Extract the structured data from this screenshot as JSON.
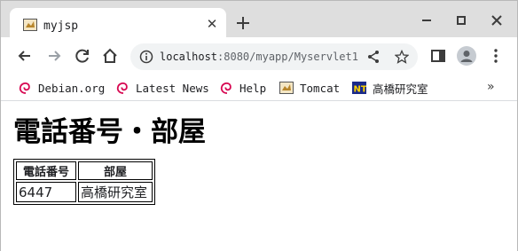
{
  "tab": {
    "title": "myjsp"
  },
  "address": {
    "host": "localhost",
    "rest": ":8080/myapp/Myservlet1"
  },
  "bookmarks": [
    {
      "label": "Debian.org",
      "icon": "debian-swirl-icon"
    },
    {
      "label": "Latest News",
      "icon": "debian-swirl-icon"
    },
    {
      "label": "Help",
      "icon": "debian-swirl-icon"
    },
    {
      "label": "Tomcat",
      "icon": "tomcat-icon"
    },
    {
      "label": "高橋研究室",
      "icon": "nt-badge-icon"
    }
  ],
  "bookmarks_overflow": "»",
  "page": {
    "title": "電話番号・部屋",
    "table": {
      "headers": [
        "電話番号",
        "部屋"
      ],
      "rows": [
        [
          "6447",
          "高橋研究室"
        ]
      ]
    }
  },
  "colors": {
    "tabstrip": "#dedede",
    "omnibox": "#f1f3f4",
    "debian": "#d70751",
    "nt_badge": "#1a2a8a"
  }
}
